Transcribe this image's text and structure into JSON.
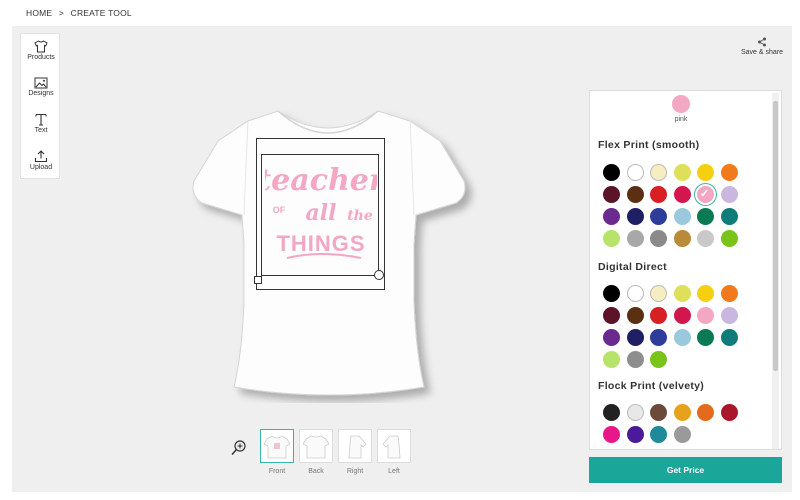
{
  "breadcrumb": {
    "home": "HOME",
    "sep": ">",
    "current": "CREATE TOOL"
  },
  "toolbar": {
    "products": "Products",
    "designs": "Designs",
    "text": "Text",
    "upload": "Upload"
  },
  "save_share": "Save & share",
  "design": {
    "line1": "teacher",
    "line2a": "OF",
    "line2b": "all",
    "line2c": "the",
    "line3": "THINGS",
    "ink_color": "#f4a7c3"
  },
  "views": [
    {
      "label": "Front"
    },
    {
      "label": "Back"
    },
    {
      "label": "Right"
    },
    {
      "label": "Left"
    }
  ],
  "selected_color": {
    "name": "pink",
    "hex": "#f4a7c3"
  },
  "sections": [
    {
      "title": "Flex Print (smooth)",
      "colors": [
        "#000000",
        "#ffffff",
        "#f6eec0",
        "#dfe05a",
        "#f5cf12",
        "#f07a1c",
        "#5b1428",
        "#5b2f12",
        "#d82024",
        "#d2174f",
        "#f4a7c3",
        "#cab7e0",
        "#6b2a8f",
        "#1f1f63",
        "#2e3d9a",
        "#9ac8dd",
        "#0a7a54",
        "#0e7c7a",
        "#b7e36a",
        "#a8a8a8",
        "#8a8a8a",
        "#b88a3a",
        "#c9c9c9",
        "#7ac41a"
      ]
    },
    {
      "title": "Digital Direct",
      "colors": [
        "#000000",
        "#ffffff",
        "#f6eec0",
        "#dfe05a",
        "#f5cf12",
        "#f07a1c",
        "#5b1428",
        "#5b2f12",
        "#d82024",
        "#d2174f",
        "#f4a7c3",
        "#cab7e0",
        "#6b2a8f",
        "#1f1f63",
        "#2e3d9a",
        "#9ac8dd",
        "#0a7a54",
        "#0e7c7a",
        "#b7e36a",
        "#8e8e8e",
        "#7ac41a"
      ]
    },
    {
      "title": "Flock Print (velvety)",
      "colors": [
        "#222222",
        "#e8e8e8",
        "#6b4a3a",
        "#e6a21c",
        "#e46a1e",
        "#a8182a",
        "#e8188a",
        "#4a1a9a",
        "#1e8a9a",
        "#9a9a9a"
      ]
    }
  ],
  "get_price": "Get Price"
}
